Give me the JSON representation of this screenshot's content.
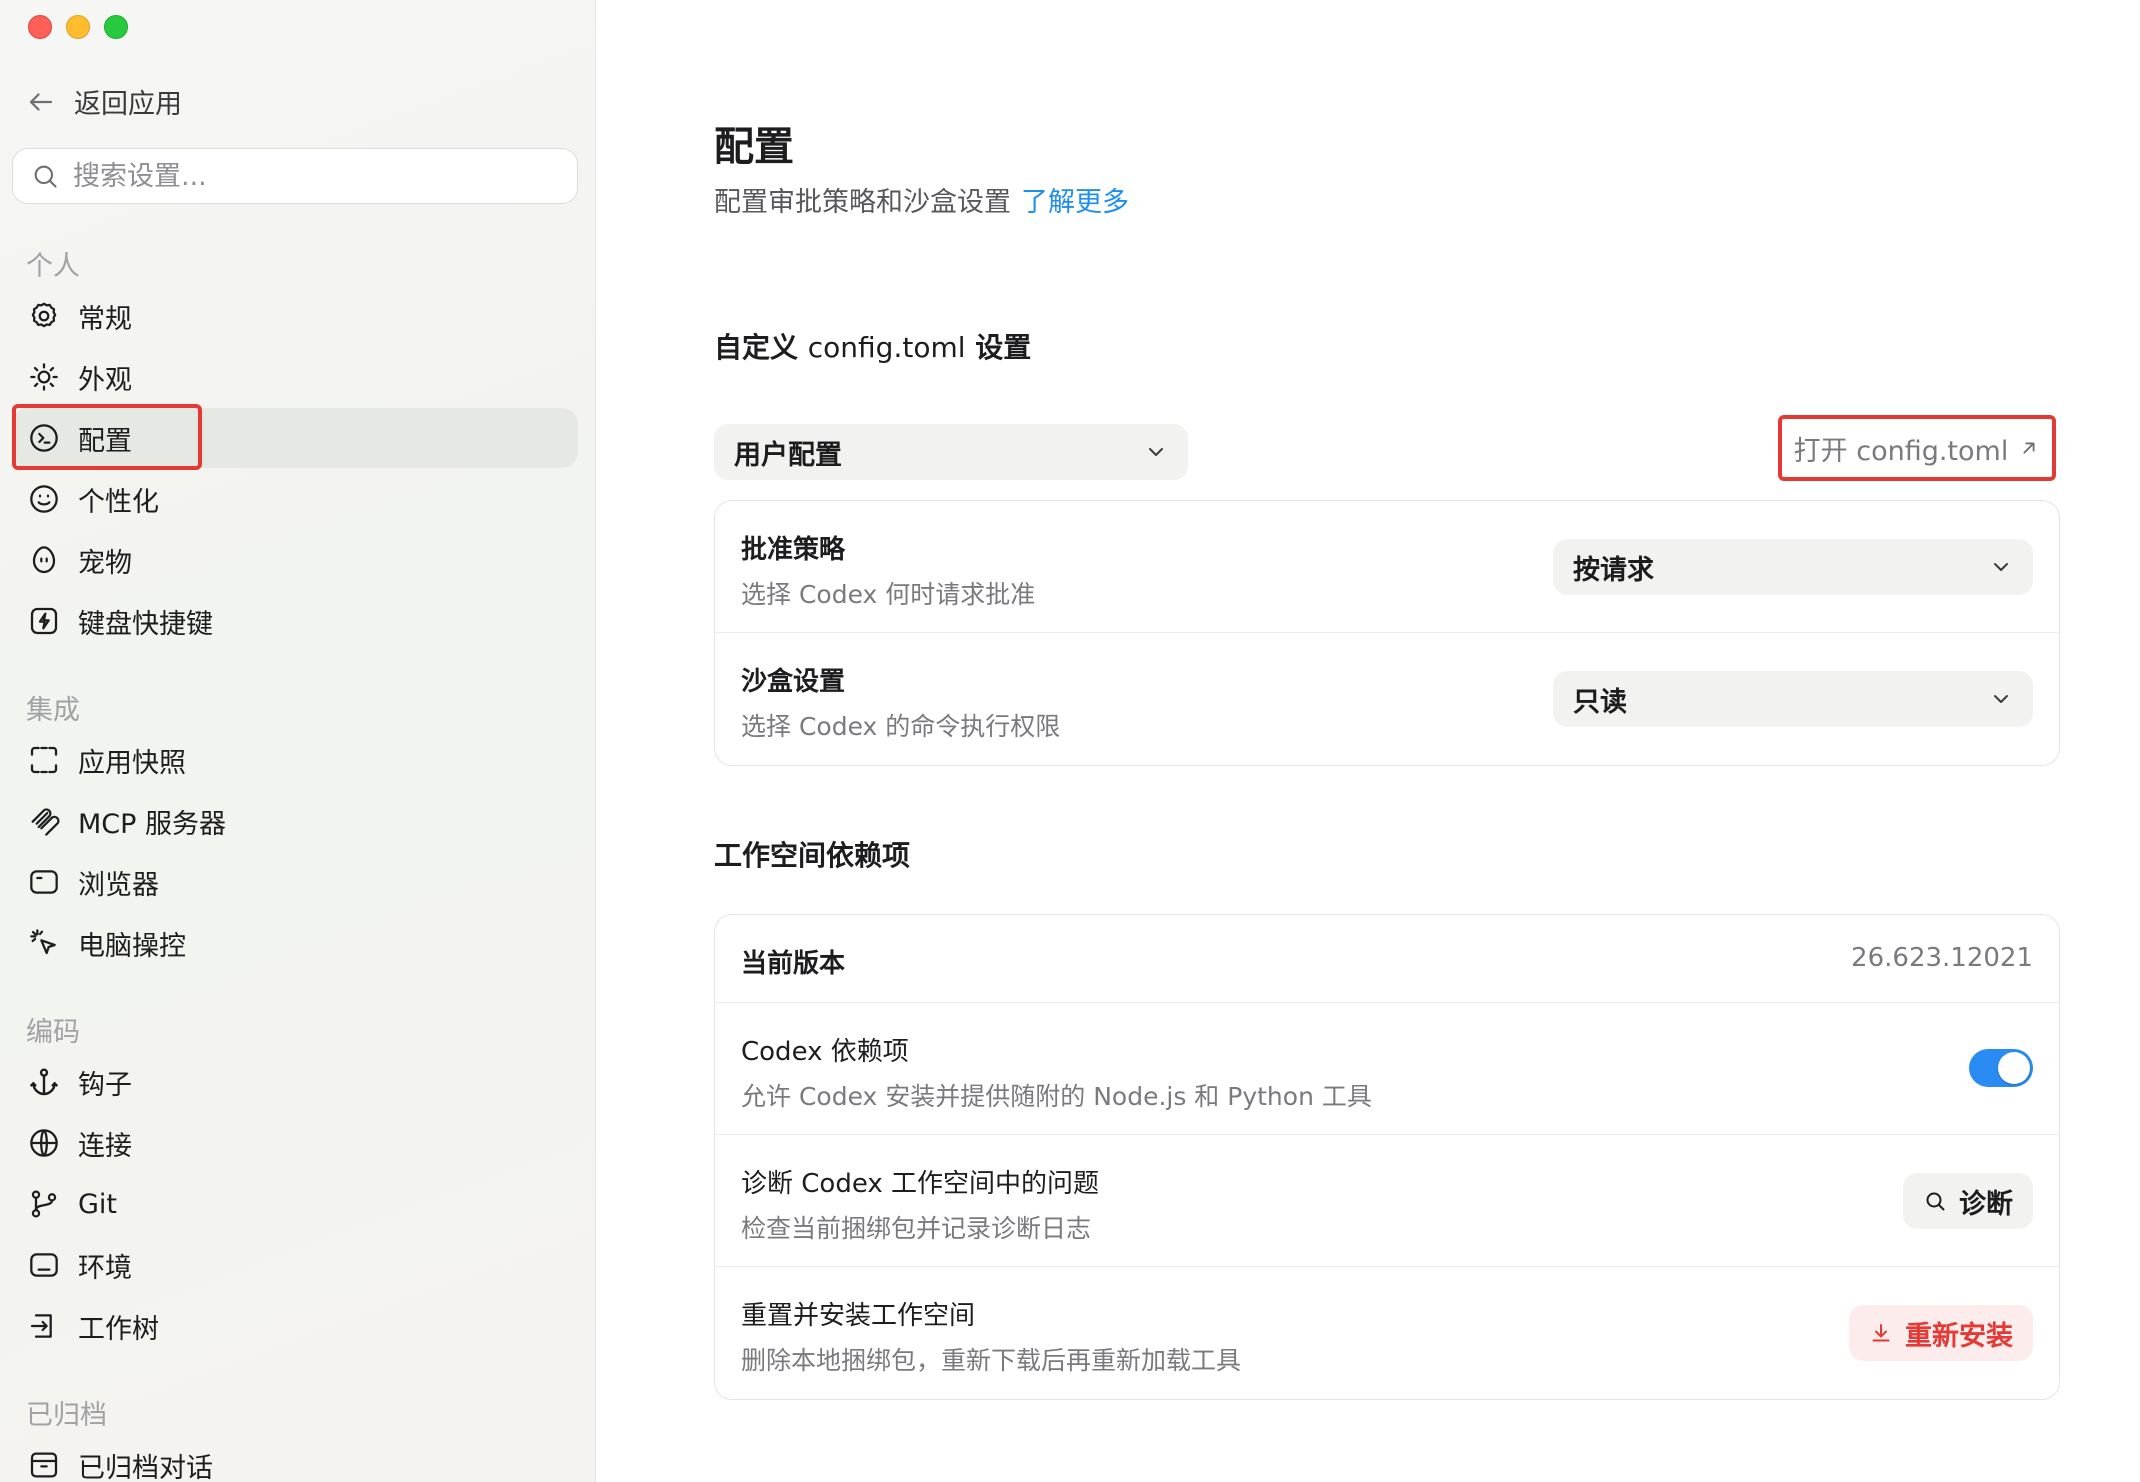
{
  "sidebar": {
    "back_label": "返回应用",
    "search_placeholder": "搜索设置...",
    "sections": {
      "personal": "个人",
      "integrations": "集成",
      "coding": "编码",
      "archived": "已归档"
    },
    "items": {
      "general": "常规",
      "appearance": "外观",
      "config": "配置",
      "personalization": "个性化",
      "pets": "宠物",
      "shortcuts": "键盘快捷键",
      "app_snapshot": "应用快照",
      "mcp": "MCP 服务器",
      "browser": "浏览器",
      "computer_control": "电脑操控",
      "hooks": "钩子",
      "connections": "连接",
      "git": "Git",
      "environments": "环境",
      "worktrees": "工作树",
      "archived_chats": "已归档对话"
    },
    "icons": [
      "gear-icon",
      "sun-icon",
      "terminal-icon",
      "smile-icon",
      "egg-icon",
      "keyboard-icon",
      "frame-icon",
      "mcp-icon",
      "browser-icon",
      "cursor-click-icon",
      "anchor-icon",
      "globe-icon",
      "git-branch-icon",
      "monitor-icon",
      "worktree-icon",
      "archive-box-icon"
    ]
  },
  "main": {
    "title": "配置",
    "subtitle": "配置审批策略和沙盒设置",
    "learn_more": "了解更多",
    "custom_heading_prefix": "自定义",
    "custom_heading_file": "config.toml",
    "custom_heading_suffix": "设置",
    "profile_select": "用户配置",
    "open_config": "打开 config.toml",
    "approval": {
      "title": "批准策略",
      "desc": "选择 Codex 何时请求批准",
      "value": "按请求"
    },
    "sandbox": {
      "title": "沙盒设置",
      "desc": "选择 Codex 的命令执行权限",
      "value": "只读"
    },
    "workspace_heading": "工作空间依赖项",
    "current_version": {
      "title": "当前版本",
      "value": "26.623.12021"
    },
    "codex_deps": {
      "title": "Codex 依赖项",
      "desc": "允许 Codex 安装并提供随附的 Node.js 和 Python 工具",
      "enabled": true
    },
    "diagnose": {
      "title": "诊断 Codex 工作空间中的问题",
      "desc": "检查当前捆绑包并记录诊断日志",
      "button": "诊断"
    },
    "reinstall": {
      "title": "重置并安装工作空间",
      "desc": "删除本地捆绑包，重新下载后再重新加载工具",
      "button": "重新安装"
    }
  },
  "colors": {
    "accent": "#2a8cf2",
    "link": "#1f8ef1",
    "danger": "#e53935",
    "highlight_outline": "#e53935"
  }
}
